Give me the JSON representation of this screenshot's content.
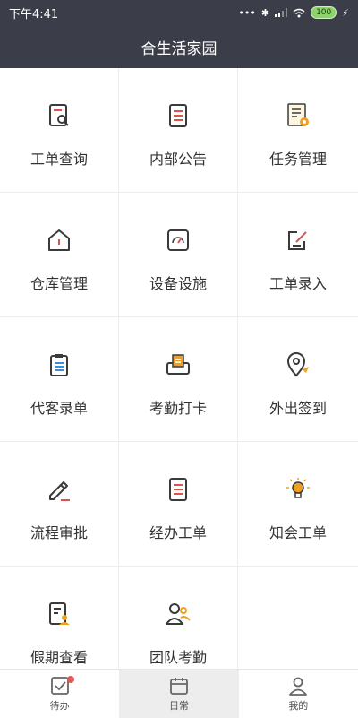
{
  "status_bar": {
    "time": "下午4:41",
    "battery": "100"
  },
  "header": {
    "title": "合生活家园"
  },
  "grid": {
    "items": [
      {
        "label": "工单查询",
        "icon": "document-search-icon"
      },
      {
        "label": "内部公告",
        "icon": "notice-document-icon"
      },
      {
        "label": "任务管理",
        "icon": "task-document-gear-icon"
      },
      {
        "label": "仓库管理",
        "icon": "warehouse-house-icon"
      },
      {
        "label": "设备设施",
        "icon": "gauge-icon"
      },
      {
        "label": "工单录入",
        "icon": "edit-form-icon"
      },
      {
        "label": "代客录单",
        "icon": "clipboard-icon"
      },
      {
        "label": "考勤打卡",
        "icon": "clock-in-printer-icon"
      },
      {
        "label": "外出签到",
        "icon": "location-pin-icon"
      },
      {
        "label": "流程审批",
        "icon": "pencil-icon"
      },
      {
        "label": "经办工单",
        "icon": "handled-document-icon"
      },
      {
        "label": "知会工单",
        "icon": "lightbulb-icon"
      },
      {
        "label": "假期查看",
        "icon": "leave-document-person-icon"
      },
      {
        "label": "团队考勤",
        "icon": "team-users-icon"
      }
    ]
  },
  "tabbar": {
    "tabs": [
      {
        "label": "待办",
        "icon": "checkbox-icon"
      },
      {
        "label": "日常",
        "icon": "calendar-icon"
      },
      {
        "label": "我的",
        "icon": "person-icon"
      }
    ]
  },
  "colors": {
    "header_bg": "#3b3d48",
    "accent_orange": "#f0a020",
    "accent_red": "#d9534f",
    "accent_blue": "#3b8fd6"
  }
}
